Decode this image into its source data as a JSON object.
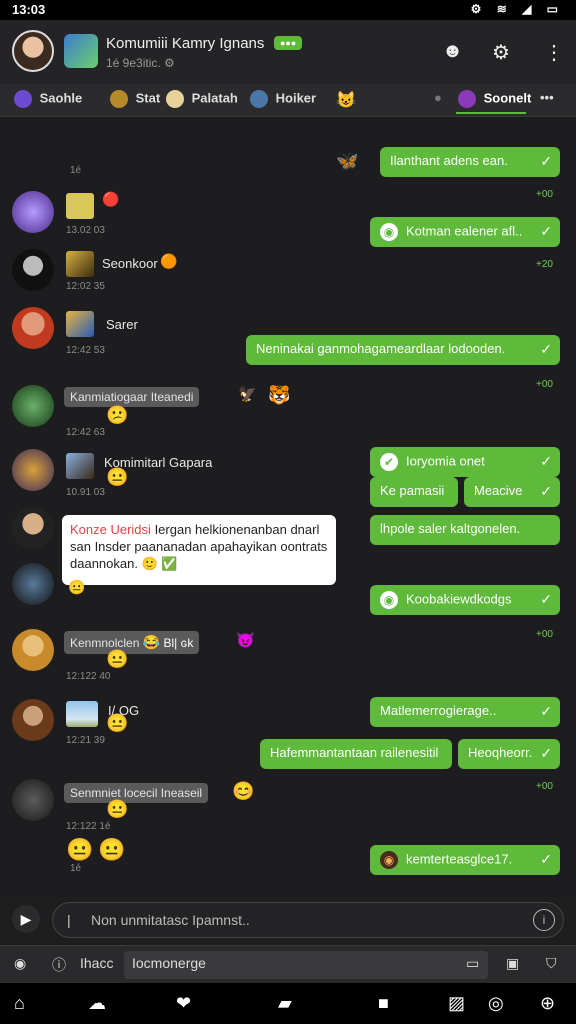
{
  "status_bar": {
    "time": "13:03",
    "icons": "⚙ ≋ ◢ ▭"
  },
  "header": {
    "title": "Komumiii Kamry Ignans",
    "badge": "●●●",
    "subtitle": "1é 9e3itic. ⚙",
    "icons": [
      "people-icon",
      "settings-icon",
      "more-vertical-icon"
    ]
  },
  "tabs": [
    {
      "label": "Saohle"
    },
    {
      "label": "Stat"
    },
    {
      "label": "Palatah"
    },
    {
      "label": "Hoiker"
    },
    {
      "label": "Soonelt"
    }
  ],
  "chat": {
    "incoming": [
      {
        "name": "",
        "meta": "1é"
      },
      {
        "name": "",
        "meta": "13.02 03"
      },
      {
        "name": "Seonkoor",
        "meta": "12:02 35"
      },
      {
        "name": "Sarer",
        "meta": "12:42 53"
      },
      {
        "name": "Kanmiatiogaar Iteanedi",
        "meta": "12:42 63"
      },
      {
        "name": "Komimitarl Gapara",
        "meta": "10.91 03"
      },
      {
        "name": "",
        "meta": ""
      },
      {
        "name": "Kenmnolclen",
        "meta": "12:122 40",
        "tag": "Bl| ɢk"
      },
      {
        "name": "I/ OG",
        "meta": "12:21 39"
      },
      {
        "name": "Senmniet locecil Ineaseil",
        "meta": "12:122 1é"
      }
    ],
    "outgoing": [
      {
        "text": "Ilanthant adens ean.",
        "time": "+00"
      },
      {
        "text": "Kotman ealener afl..",
        "time": "+20"
      },
      {
        "text": "Neninakai ganmohagameardlaar lodooden.",
        "time": "+00"
      },
      {
        "text": "Ioryomia onet",
        "time": ""
      },
      {
        "text": "Ke pamasii",
        "time": ""
      },
      {
        "text": "Meacive",
        "time": ""
      },
      {
        "text": "lhpole saler kaltgonelen.",
        "time": ""
      },
      {
        "text": "Koobakiewdkodgs",
        "time": "+00"
      },
      {
        "text": "Matlemerrogierage..",
        "time": ""
      },
      {
        "text": "Hafemmantantaan railenesitil",
        "time": ""
      },
      {
        "text": "Heoqheorr.",
        "time": "+00"
      },
      {
        "text": "kemterteasglce17.",
        "time": ""
      }
    ],
    "quote": {
      "highlight": "Konze Ueridsi",
      "body": "Iergan helkionenanban dnarl san Insder paananadan apahayikan oontrats daannokan. 🙂 ✅"
    }
  },
  "composer": {
    "placeholder": "Non unmitatasc Ipamnst.."
  },
  "tools": {
    "label": "Ihacc",
    "field_value": "Iocmonerge"
  },
  "bottom_nav": [
    "home-icon",
    "cloud-icon",
    "heart-icon",
    "folder-icon",
    "square-icon",
    "image-icon",
    "game-icon",
    "globe-icon"
  ]
}
